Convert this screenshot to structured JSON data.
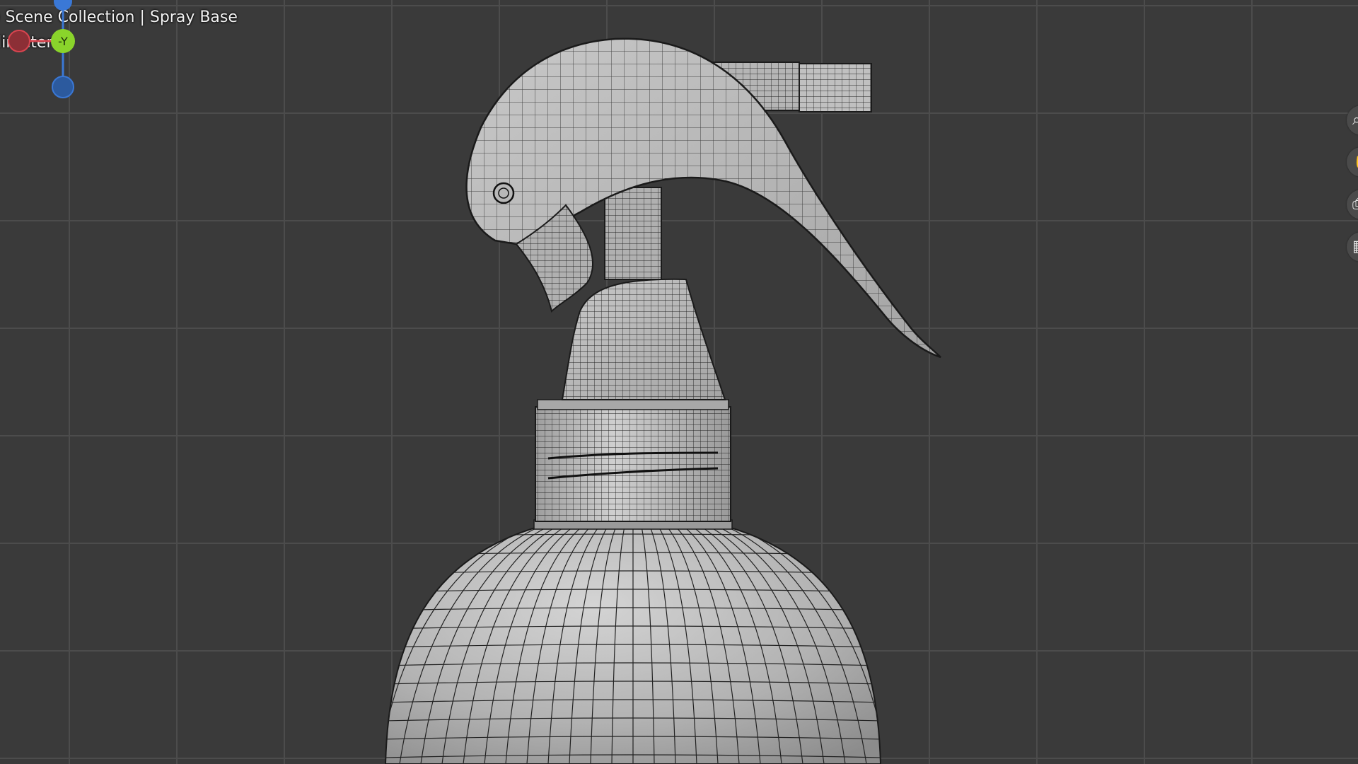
{
  "overlay": {
    "line1": ") Scene Collection | Spray Base",
    "line2": "llimeters"
  },
  "gizmo": {
    "y_axis_label": "-Y",
    "colors": {
      "x": "#d9444f",
      "y": "#8ad42b",
      "z": "#3a78d6"
    }
  },
  "navigation": {
    "zoom_icon": "magnifier-icon",
    "pan_icon": "hand-icon",
    "camera_icon": "camera-icon",
    "grid_icon": "grid-icon"
  },
  "colors": {
    "background": "#3a3a3a",
    "grid_minor": "#4a4a4a",
    "mesh_fill": "#b8b8b8",
    "wire": "#1a1a1a"
  }
}
